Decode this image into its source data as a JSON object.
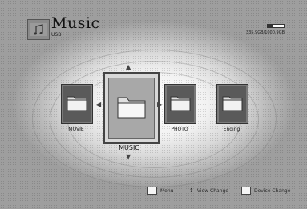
{
  "header": {
    "title": "Music",
    "subtitle": "USB",
    "storage_text": "335.9GB/1000.9GB",
    "storage_fraction": 0.34
  },
  "menu": {
    "items": [
      {
        "label": "MOVIE",
        "icon": "folder-icon"
      },
      {
        "label": "MUSIC",
        "icon": "folder-icon",
        "selected": true
      },
      {
        "label": "PHOTO",
        "icon": "folder-icon"
      },
      {
        "label": "Ending",
        "icon": "folder-icon"
      }
    ]
  },
  "footer": {
    "menu_label": "Menu",
    "view_change_label": "View Change",
    "device_change_label": "Device Change"
  }
}
